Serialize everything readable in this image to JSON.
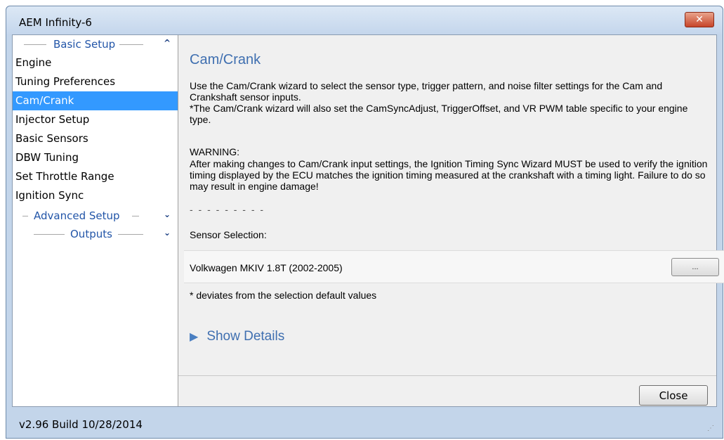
{
  "window": {
    "title": "AEM Infinity-6",
    "close_label": "✕"
  },
  "sidebar": {
    "basic_setup": {
      "label": "Basic Setup",
      "chev": "^"
    },
    "items": [
      {
        "label": "Engine"
      },
      {
        "label": "Tuning Preferences"
      },
      {
        "label": "Cam/Crank"
      },
      {
        "label": "Injector Setup"
      },
      {
        "label": "Basic Sensors"
      },
      {
        "label": "DBW Tuning"
      },
      {
        "label": "Set Throttle Range"
      },
      {
        "label": "Ignition Sync"
      }
    ],
    "advanced_setup": {
      "label": "Advanced Setup",
      "chev": "⌄"
    },
    "outputs": {
      "label": "Outputs",
      "chev": "⌄"
    }
  },
  "main": {
    "title": "Cam/Crank",
    "desc1": "Use the Cam/Crank wizard to select the sensor type, trigger pattern, and noise filter settings for the Cam and Crankshaft sensor inputs.",
    "desc2": "*The Cam/Crank wizard will also set the CamSyncAdjust, TriggerOffset, and VR PWM table specific to your engine type.",
    "warning_title": "WARNING:",
    "warning_body": "After making changes to Cam/Crank input settings, the Ignition Timing Sync Wizard MUST be used to verify the ignition timing displayed by the ECU matches the ignition timing measured at the crankshaft with a timing light. Failure to do so may result in engine damage!",
    "dashes": "- - - - - - - - -",
    "sensor_label": "Sensor Selection:",
    "sensor_value": "Volkwagen MKIV 1.8T (2002-2005)",
    "browse_label": "...",
    "deviates": "* deviates from the selection default values",
    "show_details": "Show Details"
  },
  "footer": {
    "close_label": "Close",
    "version": "v2.96 Build 10/28/2014"
  },
  "colors": {
    "selected": "#3399ff",
    "link_blue": "#3f6fb0",
    "section_blue": "#2255a8"
  }
}
